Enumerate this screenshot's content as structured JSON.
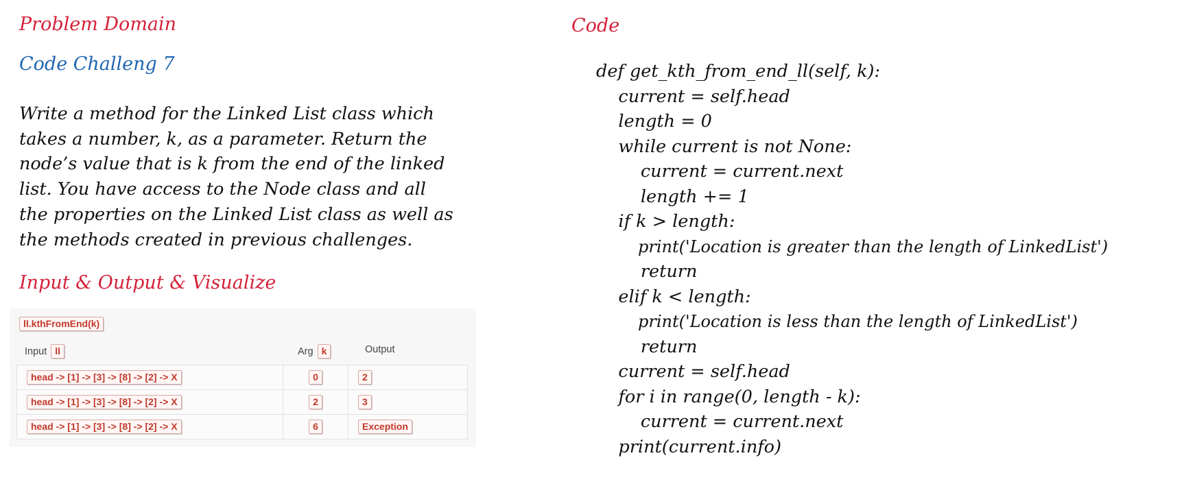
{
  "problem": {
    "heading": "Problem Domain",
    "challenge_title": "Code Challeng 7",
    "description_lines": [
      "Write a method for the Linked List class which",
      "takes a number, k, as a parameter. Return the",
      "node’s value that is k from the end of the linked",
      "list. You have access to the Node class and all",
      "the properties on the Linked List class as well as",
      "the methods created in previous challenges."
    ]
  },
  "visualize": {
    "heading": "Input & Output & Visualize",
    "function_chip": "ll.kthFromEnd(k)",
    "headers": {
      "input": "Input",
      "input_chip": "ll",
      "arg": "Arg",
      "arg_chip": "k",
      "output": "Output"
    },
    "rows": [
      {
        "input": "head -> [1] -> [3] -> [8] -> [2] -> X",
        "arg": "0",
        "output": "2"
      },
      {
        "input": "head -> [1] -> [3] -> [8] -> [2] -> X",
        "arg": "2",
        "output": "3"
      },
      {
        "input": "head -> [1] -> [3] -> [8] -> [2] -> X",
        "arg": "6",
        "output": "Exception"
      }
    ]
  },
  "code": {
    "heading": "Code",
    "lines": [
      "def get_kth_from_end_ll(self, k):",
      "    current = self.head",
      "    length = 0",
      "    while current is not None:",
      "        current = current.next",
      "        length += 1",
      "    if k > length:",
      "        print('Location is greater than the length of LinkedList')",
      "        return",
      "    elif k < length:",
      "        print('Location is less than the length of LinkedList')",
      "        return",
      "    current = self.head",
      "    for i in range(0, length - k):",
      "        current = current.next",
      "    print(current.info)"
    ]
  },
  "colors": {
    "heading_red": "#d4213a",
    "heading_blue": "#1f66b0",
    "chip_text": "#c0392b"
  }
}
